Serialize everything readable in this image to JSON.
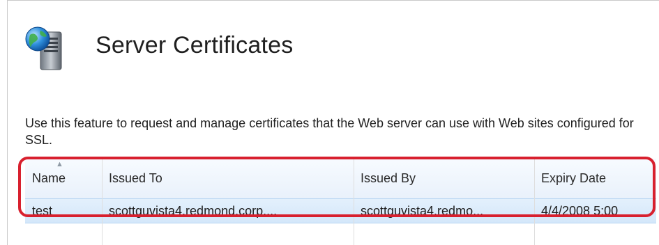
{
  "page": {
    "title": "Server Certificates",
    "description": "Use this feature to request and manage certificates that the Web server can use with Web sites configured for SSL.",
    "icon": "server-certificates-icon"
  },
  "grid": {
    "sort_indicator": "ascending",
    "columns": [
      {
        "label": "Name"
      },
      {
        "label": "Issued To"
      },
      {
        "label": "Issued By"
      },
      {
        "label": "Expiry Date"
      }
    ],
    "rows": [
      {
        "name": "test",
        "issued_to": "scottguvista4.redmond.corp....",
        "issued_by": "scottguvista4.redmo...",
        "expiry_date": "4/4/2008 5:00"
      }
    ]
  },
  "colors": {
    "highlight_border": "#d8202e",
    "selected_row": "#d4e7fa",
    "header_bg": "#e9f1fb"
  }
}
